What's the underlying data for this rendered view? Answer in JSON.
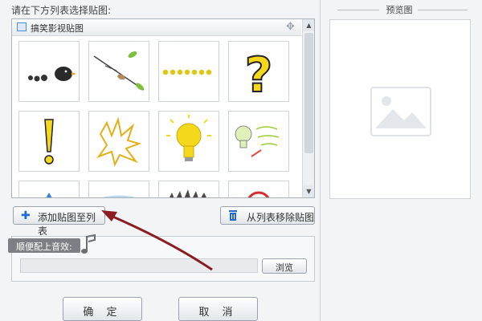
{
  "instruction": "请在下方列表选择贴图:",
  "sticker_list": {
    "title": "搞笑影视贴图",
    "stickers": [
      {
        "name": "bird-dots-sticker"
      },
      {
        "name": "branch-leaves-sticker"
      },
      {
        "name": "yellow-dots-sticker"
      },
      {
        "name": "question-mark-sticker"
      },
      {
        "name": "exclamation-mark-sticker"
      },
      {
        "name": "spiky-burst-sticker"
      },
      {
        "name": "light-bulb-sticker"
      },
      {
        "name": "light-bulb-handwriting-sticker"
      }
    ]
  },
  "buttons": {
    "add": "添加贴图至列表",
    "remove": "从列表移除贴图",
    "browse": "浏览",
    "ok": "确 定",
    "cancel": "取 消"
  },
  "audio": {
    "label": "顺便配上音效:",
    "path": ""
  },
  "preview": {
    "title": "预览图"
  },
  "colors": {
    "accent": "#1f6ad3",
    "arrow": "#8b1d22",
    "sticker_yellow": "#f4d81c"
  }
}
